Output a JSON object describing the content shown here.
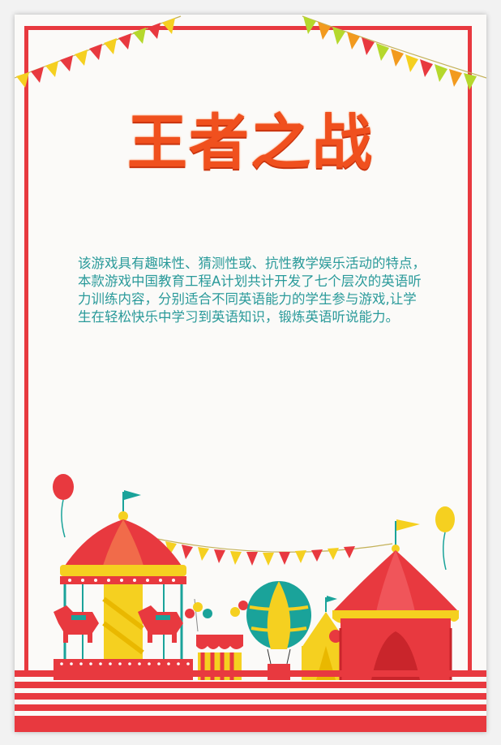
{
  "poster": {
    "title": "王者之战",
    "description": "该游戏具有趣味性、猜测性或、抗性教学娱乐活动的特点，本款游戏中国教育工程A计划共计开发了七个层次的英语听力训练内容，分别适合不同英语能力的学生参与游戏,让学生在轻松快乐中学习到英语知识，锻炼英语听说能力。"
  },
  "colors": {
    "frame": "#e8393f",
    "title": "#f0501e",
    "description_text": "#2a9a9a",
    "flag_yellow": "#f5d020",
    "flag_red": "#e8393f",
    "flag_orange": "#f29a1e",
    "flag_green": "#b5d82c",
    "teal": "#1aa39a"
  },
  "decorations": {
    "bunting_icon": "bunting-flags-icon",
    "carnival_icon": "carnival-scene-icon",
    "carousel_icon": "carousel-icon",
    "tent_icon": "circus-tent-icon",
    "hot_air_balloon_icon": "hot-air-balloon-icon",
    "balloon_icon": "balloon-icon"
  }
}
